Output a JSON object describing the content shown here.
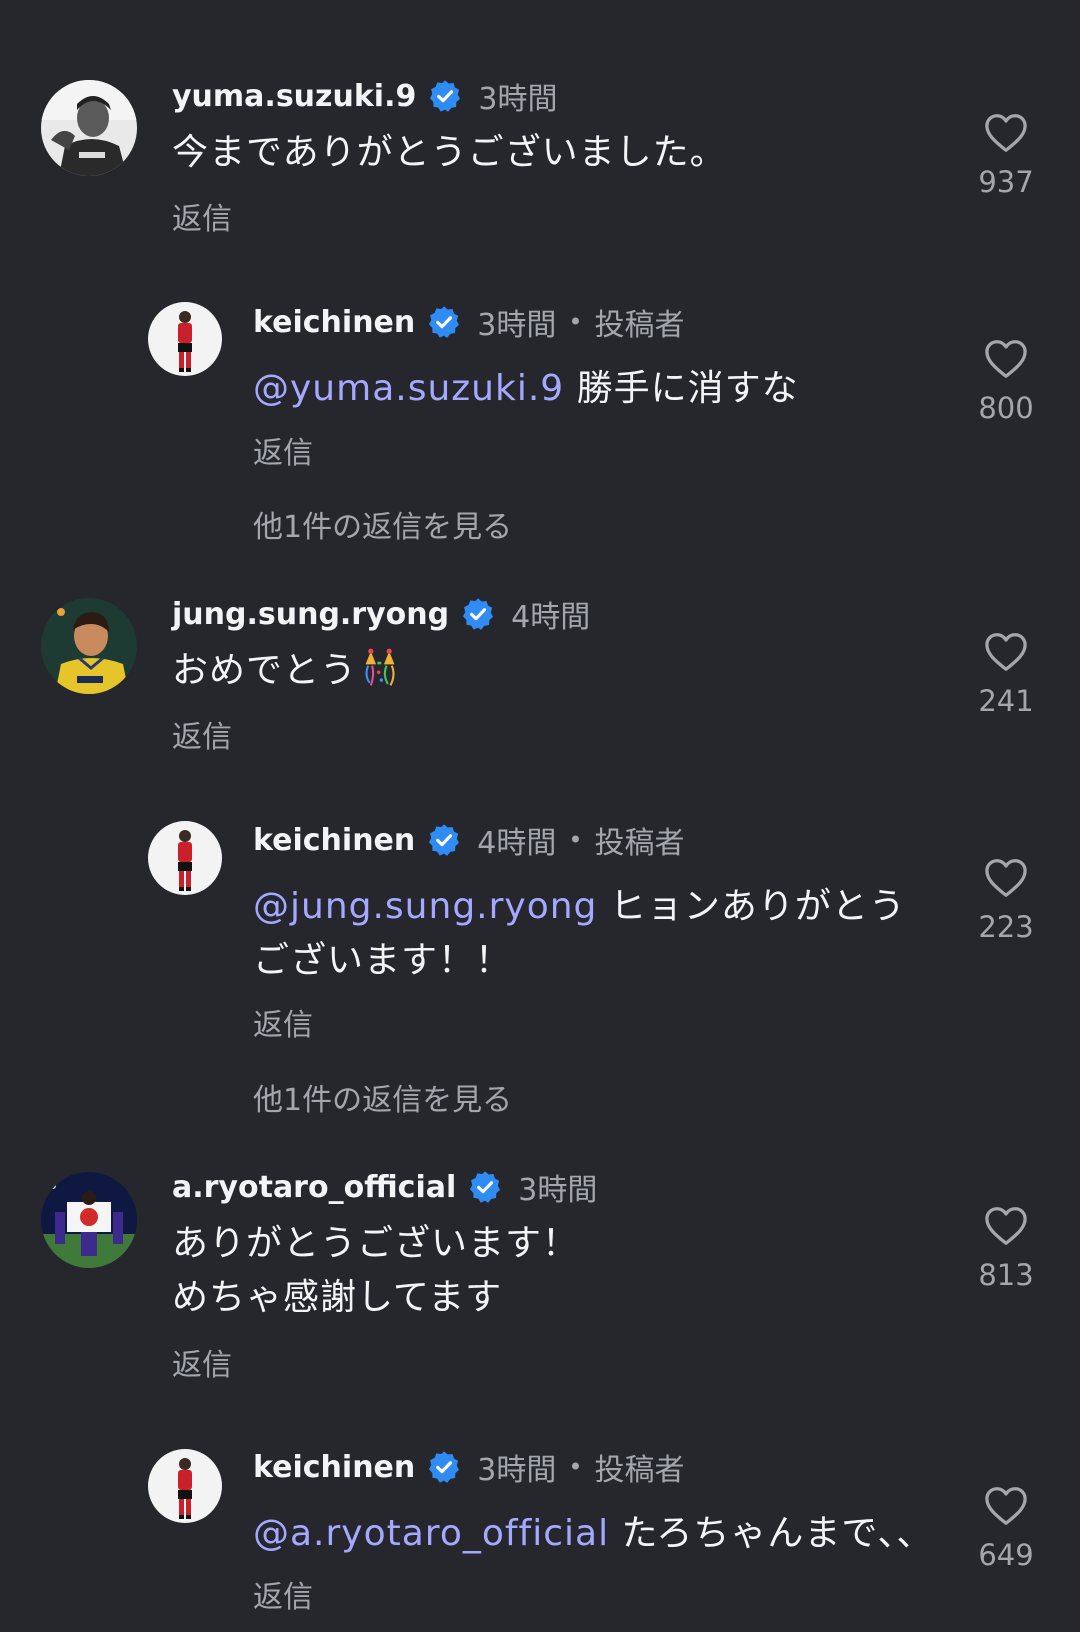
{
  "labels": {
    "reply": "返信",
    "author_badge": "投稿者",
    "dot": "•"
  },
  "comments": [
    {
      "username": "yuma.suzuki.9",
      "time": "3時間",
      "text": "今までありがとうございました。",
      "likes": "937",
      "replies": [
        {
          "username": "keichinen",
          "time": "3時間",
          "mention": "@yuma.suzuki.9",
          "text": " 勝手に消すな",
          "likes": "800"
        }
      ],
      "view_more": "他1件の返信を見る"
    },
    {
      "username": "jung.sung.ryong",
      "time": "4時間",
      "text": "おめでとう",
      "emoji": "confetti-emoji",
      "likes": "241",
      "replies": [
        {
          "username": "keichinen",
          "time": "4時間",
          "mention": "@jung.sung.ryong",
          "text": " ヒョンありがとうございます！！",
          "likes": "223"
        }
      ],
      "view_more": "他1件の返信を見る"
    },
    {
      "username": "a.ryotaro_official",
      "time": "3時間",
      "text": "ありがとうございます！",
      "text_line2": "めちゃ感謝してます",
      "likes": "813",
      "replies": [
        {
          "username": "keichinen",
          "time": "3時間",
          "mention": "@a.ryotaro_official",
          "text": " たろちゃんまで､､",
          "likes": "649"
        }
      ]
    }
  ],
  "colors": {
    "background": "#25272d",
    "mention": "#a4a9ff",
    "verified": "#2f8cf5",
    "muted": "#a3a6ad"
  }
}
